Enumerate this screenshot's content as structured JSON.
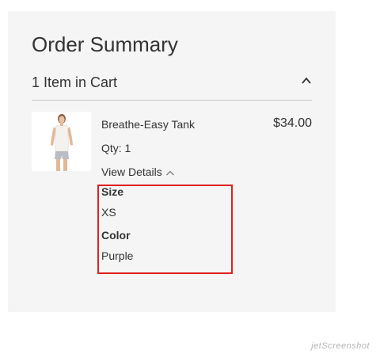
{
  "order_summary": {
    "title": "Order Summary",
    "cart_count_label": "1 Item in Cart",
    "item": {
      "name": "Breathe-Easy Tank",
      "price": "$34.00",
      "qty_label": "Qty: 1",
      "view_details_label": "View Details",
      "options": [
        {
          "label": "Size",
          "value": "XS"
        },
        {
          "label": "Color",
          "value": "Purple"
        }
      ]
    }
  },
  "watermark": {
    "text": "jetScreenshot"
  },
  "colors": {
    "panel_background": "#f5f5f5",
    "text": "#333333",
    "highlight_border": "#e02020"
  },
  "icons": {
    "toggle": "chevron-up-icon",
    "details": "chevron-up-icon"
  }
}
